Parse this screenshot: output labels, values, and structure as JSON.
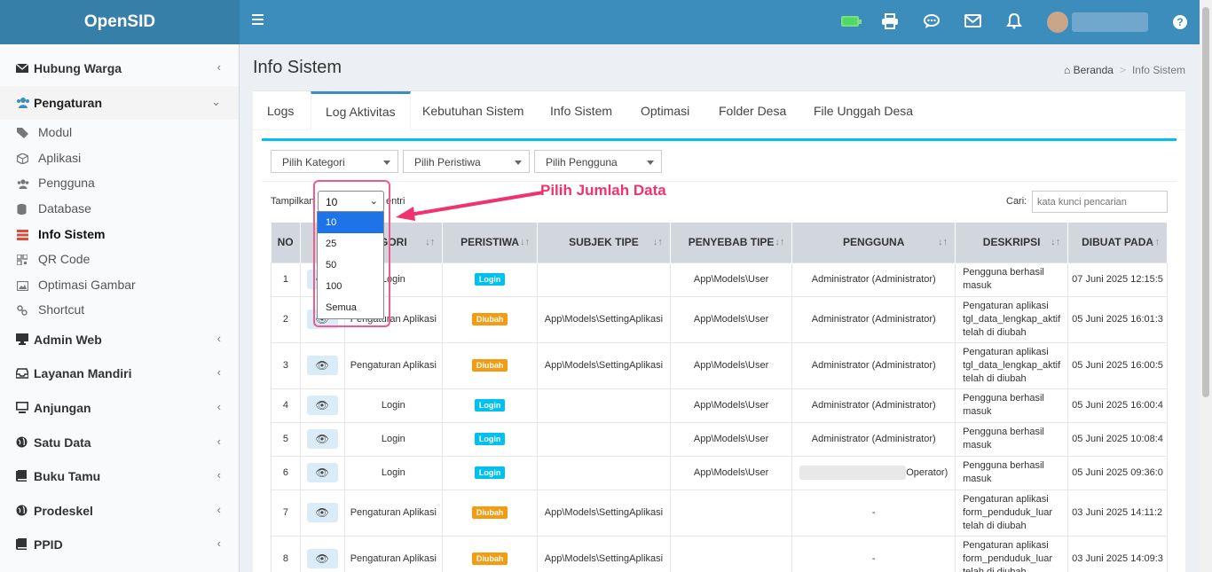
{
  "header": {
    "logo": "OpenSID",
    "help": "?",
    "icons": [
      "menu-icon",
      "battery-icon",
      "print-icon",
      "chat-icon",
      "mail-icon",
      "bell-icon",
      "avatar",
      "help-icon"
    ]
  },
  "sidebar": {
    "items": [
      {
        "label": "Hubung Warga",
        "icon": "envelope-icon"
      },
      {
        "label": "Pengaturan",
        "icon": "users-icon"
      },
      {
        "label": "Admin Web",
        "icon": "desktop-icon"
      },
      {
        "label": "Layanan Mandiri",
        "icon": "inbox-icon"
      },
      {
        "label": "Anjungan",
        "icon": "monitor-icon"
      },
      {
        "label": "Satu Data",
        "icon": "globe-icon"
      },
      {
        "label": "Buku Tamu",
        "icon": "book-icon"
      },
      {
        "label": "Prodeskel",
        "icon": "globe-icon"
      },
      {
        "label": "PPID",
        "icon": "book-icon"
      }
    ],
    "subitems": [
      {
        "label": "Modul",
        "icon": "tags-icon"
      },
      {
        "label": "Aplikasi",
        "icon": "cube-icon"
      },
      {
        "label": "Pengguna",
        "icon": "users-icon"
      },
      {
        "label": "Database",
        "icon": "database-icon"
      },
      {
        "label": "Info Sistem",
        "icon": "server-icon"
      },
      {
        "label": "QR Code",
        "icon": "qrcode-icon"
      },
      {
        "label": "Optimasi Gambar",
        "icon": "image-icon"
      },
      {
        "label": "Shortcut",
        "icon": "link-icon"
      }
    ]
  },
  "page": {
    "title": "Info Sistem",
    "breadcrumb": {
      "home": "Beranda",
      "current": "Info Sistem"
    }
  },
  "tabs": [
    "Logs",
    "Log Aktivitas",
    "Kebutuhan Sistem",
    "Info Sistem",
    "Optimasi",
    "Folder Desa",
    "File Unggah Desa"
  ],
  "filters": {
    "kategori": "Pilih Kategori",
    "peristiwa": "Pilih Peristiwa",
    "pengguna": "Pilih Pengguna"
  },
  "length": {
    "prefix": "Tampilkan",
    "suffix": "entri",
    "value": "10",
    "options": [
      "10",
      "25",
      "50",
      "100",
      "Semua"
    ]
  },
  "search": {
    "label": "Cari:",
    "placeholder": "kata kunci pencarian"
  },
  "annotation": "Pilih Jumlah Data",
  "table": {
    "headers": [
      "NO",
      "AKSI",
      "KATEGORI",
      "PERISTIWA",
      "SUBJEK TIPE",
      "PENYEBAB TIPE",
      "PENGGUNA",
      "DESKRIPSI",
      "DIBUAT PADA"
    ],
    "visible_headers": [
      "NO",
      "A",
      "GORI",
      "PERISTIWA",
      "SUBJEK TIPE",
      "PENYEBAB TIPE",
      "PENGGUNA",
      "DESKRIPSI",
      "DIBUAT PADA"
    ],
    "rows": [
      {
        "no": "1",
        "kategori": "Login",
        "peristiwa": "Login",
        "subjek": "",
        "penyebab": "App\\Models\\User",
        "pengguna": "Administrator (Administrator)",
        "deskripsi": "Pengguna berhasil masuk",
        "dibuat": "07 Juni 2025 12:15:5"
      },
      {
        "no": "2",
        "kategori": "Pengaturan Aplikasi",
        "peristiwa": "Diubah",
        "subjek": "App\\Models\\SettingAplikasi",
        "penyebab": "App\\Models\\User",
        "pengguna": "Administrator (Administrator)",
        "deskripsi": "Pengaturan aplikasi tgl_data_lengkap_aktif telah di diubah",
        "dibuat": "05 Juni 2025 16:01:3"
      },
      {
        "no": "3",
        "kategori": "Pengaturan Aplikasi",
        "peristiwa": "Diubah",
        "subjek": "App\\Models\\SettingAplikasi",
        "penyebab": "App\\Models\\User",
        "pengguna": "Administrator (Administrator)",
        "deskripsi": "Pengaturan aplikasi tgl_data_lengkap_aktif telah di diubah",
        "dibuat": "05 Juni 2025 16:00:5"
      },
      {
        "no": "4",
        "kategori": "Login",
        "peristiwa": "Login",
        "subjek": "",
        "penyebab": "App\\Models\\User",
        "pengguna": "Administrator (Administrator)",
        "deskripsi": "Pengguna berhasil masuk",
        "dibuat": "05 Juni 2025 16:00:4"
      },
      {
        "no": "5",
        "kategori": "Login",
        "peristiwa": "Login",
        "subjek": "",
        "penyebab": "App\\Models\\User",
        "pengguna": "Administrator (Administrator)",
        "deskripsi": "Pengguna berhasil masuk",
        "dibuat": "05 Juni 2025 10:08:4"
      },
      {
        "no": "6",
        "kategori": "Login",
        "peristiwa": "Login",
        "subjek": "",
        "penyebab": "App\\Models\\User",
        "pengguna": "Operator)",
        "deskripsi": "Pengguna berhasil masuk",
        "dibuat": "05 Juni 2025 09:36:0"
      },
      {
        "no": "7",
        "kategori": "Pengaturan Aplikasi",
        "peristiwa": "Diubah",
        "subjek": "App\\Models\\SettingAplikasi",
        "penyebab": "",
        "pengguna": "-",
        "deskripsi": "Pengaturan aplikasi form_penduduk_luar telah di diubah",
        "dibuat": "03 Juni 2025 14:11:2"
      },
      {
        "no": "8",
        "kategori": "Pengaturan Aplikasi",
        "peristiwa": "Diubah",
        "subjek": "App\\Models\\SettingAplikasi",
        "penyebab": "",
        "pengguna": "-",
        "deskripsi": "Pengaturan aplikasi form_penduduk_luar telah di diubah",
        "dibuat": "03 Juni 2025 14:09:3"
      }
    ]
  },
  "colors": {
    "header": "#3c8dbc",
    "logo_bg": "#367fa9",
    "accent": "#00c0ef",
    "warning": "#f39c12",
    "annotation": "#f0336e"
  }
}
